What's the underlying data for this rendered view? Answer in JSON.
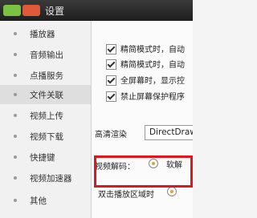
{
  "window": {
    "title": "设置"
  },
  "sidebar": {
    "items": [
      {
        "label": "播放器",
        "selected": false
      },
      {
        "label": "音频输出",
        "selected": false
      },
      {
        "label": "点播服务",
        "selected": false
      },
      {
        "label": "文件关联",
        "selected": true
      },
      {
        "label": "视频上传",
        "selected": false
      },
      {
        "label": "视频下载",
        "selected": false
      },
      {
        "label": "快捷键",
        "selected": false
      },
      {
        "label": "视频加速器",
        "selected": false
      },
      {
        "label": "其他",
        "selected": false
      }
    ]
  },
  "content": {
    "checkboxes": [
      {
        "label": "精简模式时，自动",
        "checked": true
      },
      {
        "label": "精简模式时，自动",
        "checked": true
      },
      {
        "label": "全屏幕时，显示控",
        "checked": true
      },
      {
        "label": "禁止屏幕保护程序",
        "checked": true
      }
    ],
    "render": {
      "label": "高清渲染",
      "value": "DirectDraw"
    },
    "decode": {
      "label": "视频解码：",
      "option": "软解"
    },
    "double_click": {
      "label": "双击播放区域时"
    }
  },
  "colors": {
    "highlight": "#e3151c",
    "radio_accent": "#e8a13a"
  }
}
